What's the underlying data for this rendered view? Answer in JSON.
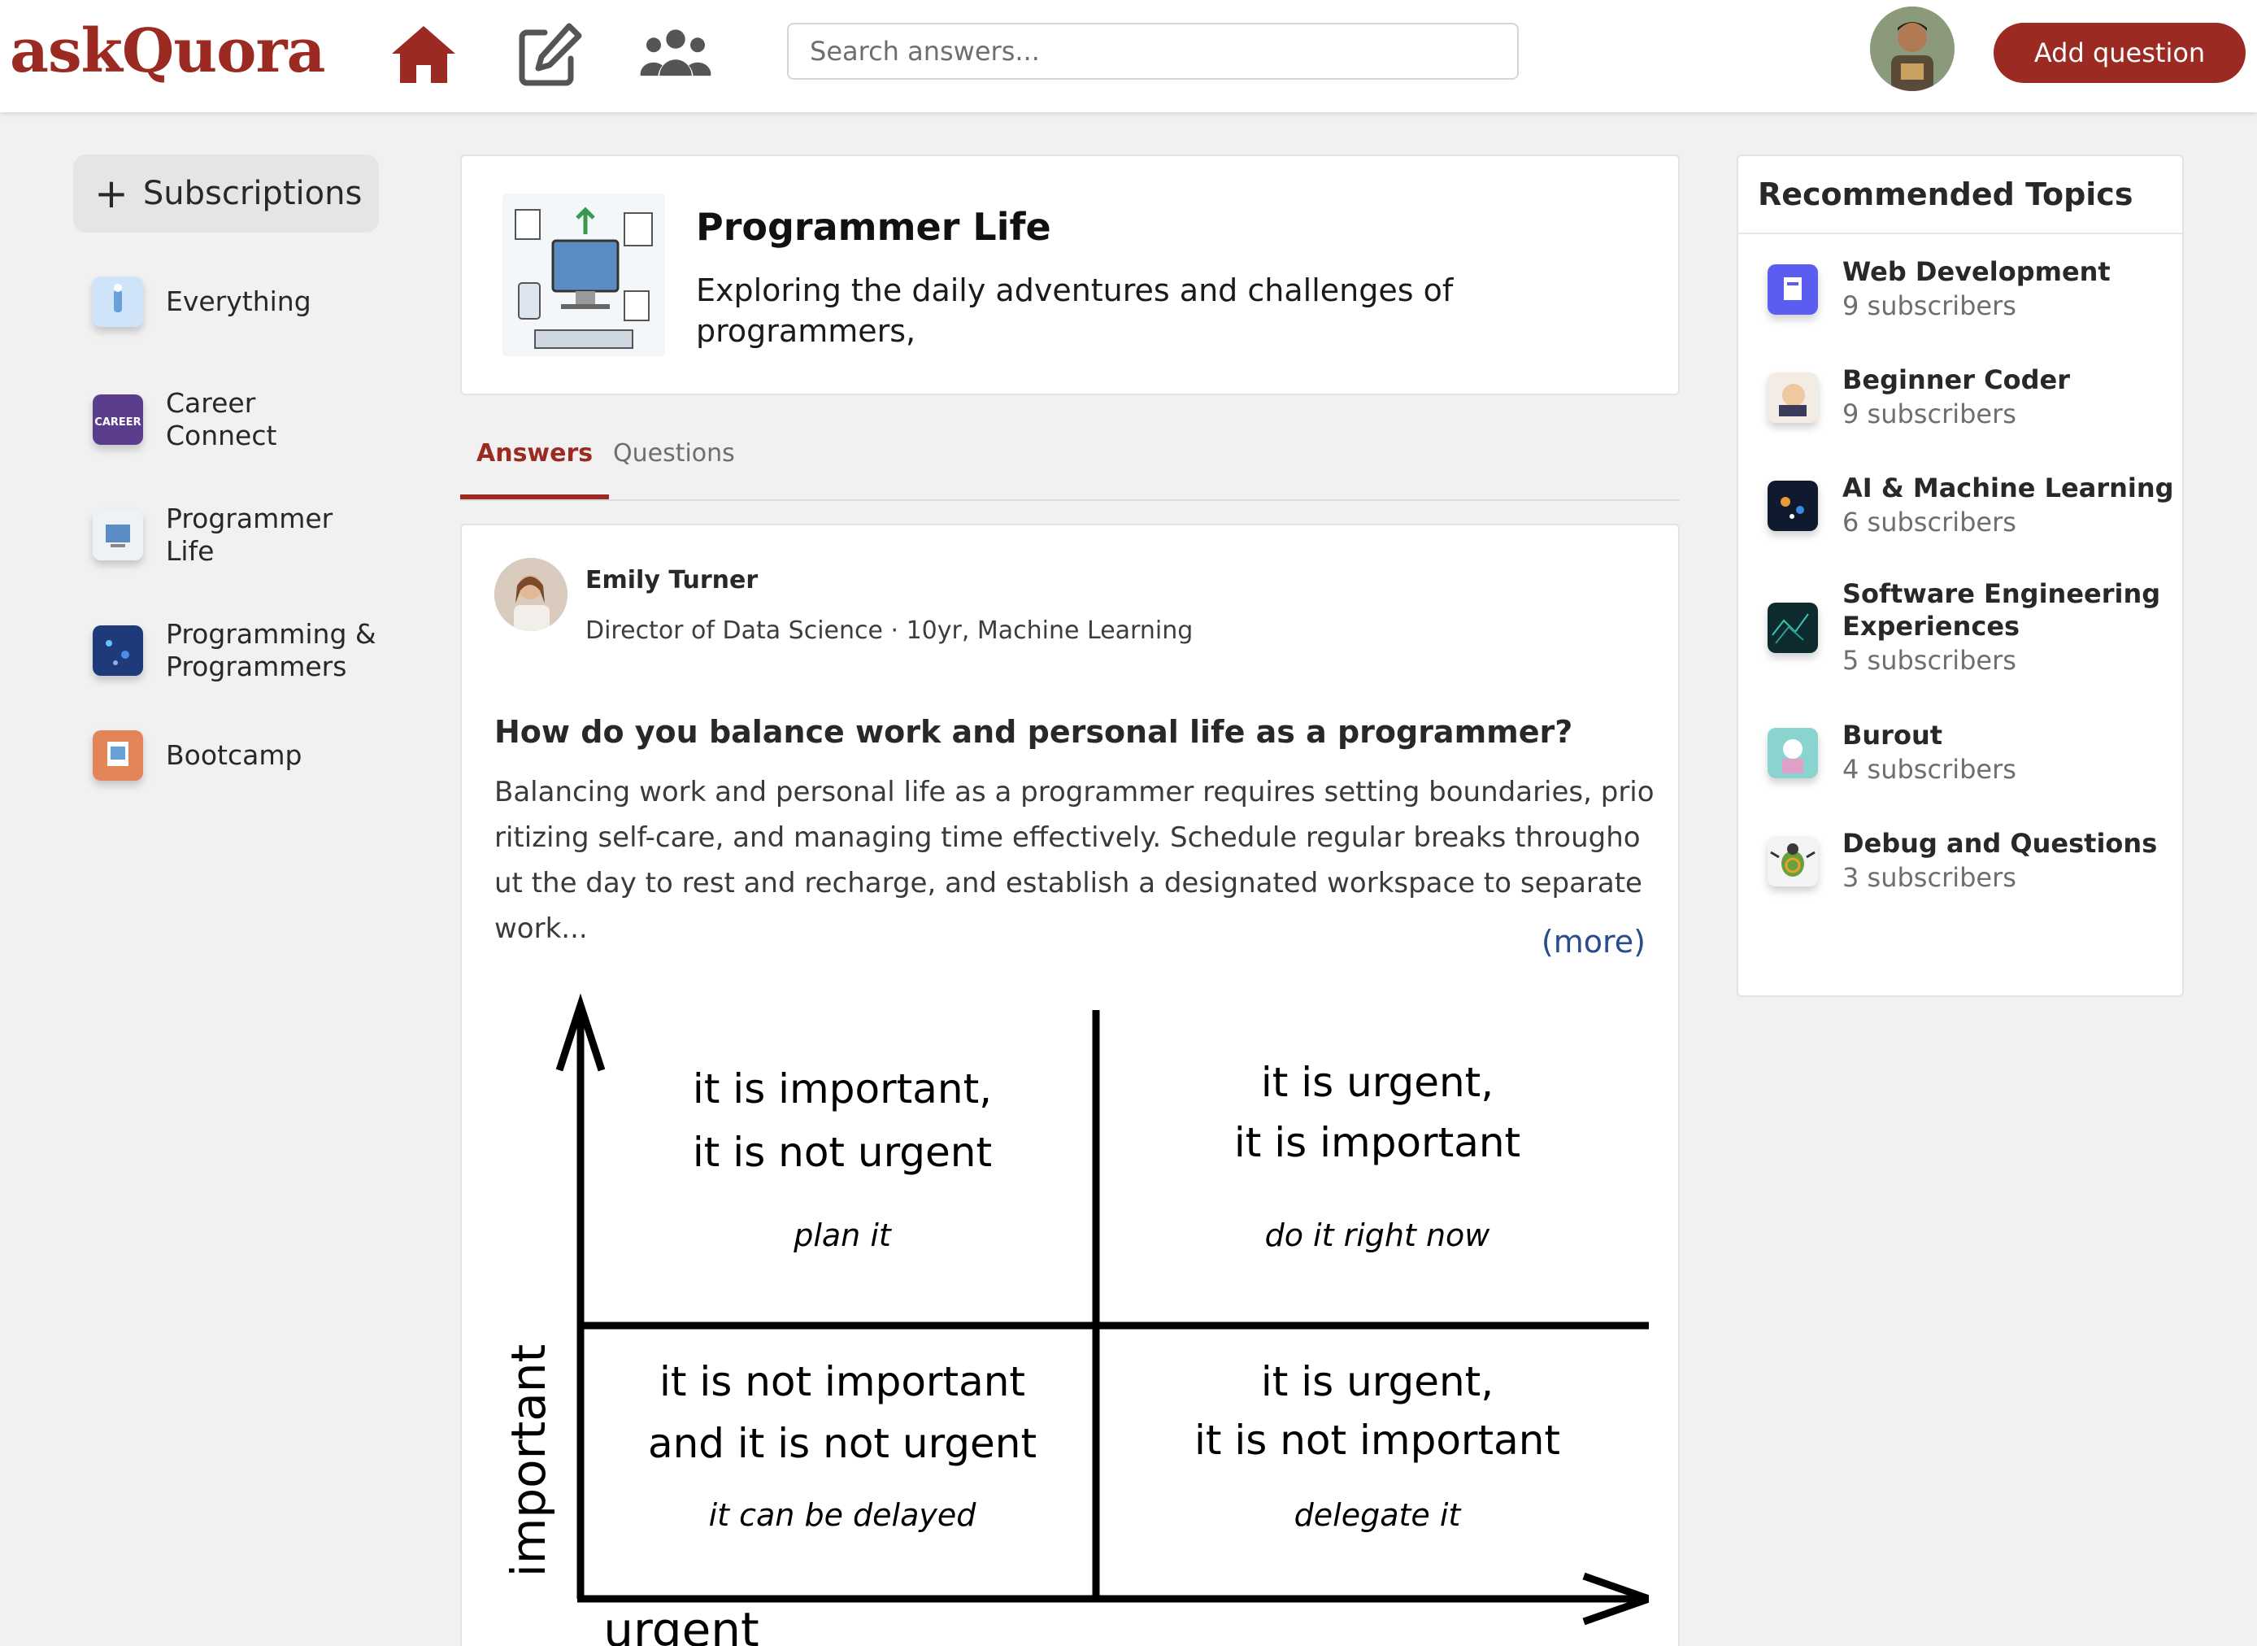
{
  "header": {
    "logo": "askQuora",
    "search_placeholder": "Search answers...",
    "add_question_label": "Add question",
    "nav_icons": [
      "home-icon",
      "edit-icon",
      "people-icon"
    ]
  },
  "sidebar": {
    "subscriptions_label": "Subscriptions",
    "items": [
      {
        "line1": "Everything",
        "line2": ""
      },
      {
        "line1": "Career",
        "line2": "Connect"
      },
      {
        "line1": "Programmer",
        "line2": "Life"
      },
      {
        "line1": "Programming &",
        "line2": "Programmers"
      },
      {
        "line1": "Bootcamp",
        "line2": ""
      }
    ]
  },
  "space": {
    "title": "Programmer Life",
    "description": "Exploring the daily adventures and challenges of programmers,"
  },
  "tabs": [
    "Answers",
    "Questions"
  ],
  "answer": {
    "author": "Emily Turner",
    "credential": "Director of Data Science · 10yr, Machine Learning",
    "question": "How do you balance work and personal life as a programmer?",
    "body": "Balancing work and personal life as a programmer requires setting boundaries, prioritizing self-care, and managing time effectively. Schedule regular breaks throughout the day to rest and recharge, and establish a designated workspace to separate work...",
    "more_label": "(more)",
    "matrix": {
      "y_axis": "important",
      "x_axis": "urgent",
      "q1": {
        "line1": "it is important,",
        "line2": "it is not urgent",
        "action": "plan it"
      },
      "q2": {
        "line1": "it is urgent,",
        "line2": "it is important",
        "action": "do it right now"
      },
      "q3": {
        "line1": "it is not important",
        "line2": "and it is not urgent",
        "action": "it can be delayed"
      },
      "q4": {
        "line1": "it is urgent,",
        "line2": "it is not important",
        "action": "delegate it"
      }
    }
  },
  "recommended": {
    "title": "Recommended Topics",
    "items": [
      {
        "name1": "Web Development",
        "name2": "",
        "subs": "9 subscribers"
      },
      {
        "name1": "Beginner Coder",
        "name2": "",
        "subs": "9 subscribers"
      },
      {
        "name1": "AI & Machine Learning",
        "name2": "",
        "subs": "6 subscribers"
      },
      {
        "name1": "Software Engineering",
        "name2": "Experiences",
        "subs": "5 subscribers"
      },
      {
        "name1": "Burout",
        "name2": "",
        "subs": "4 subscribers"
      },
      {
        "name1": "Debug and Questions",
        "name2": "",
        "subs": "3 subscribers"
      }
    ]
  },
  "colors": {
    "brand": "#9b2a22",
    "link": "#2b4c8a"
  }
}
